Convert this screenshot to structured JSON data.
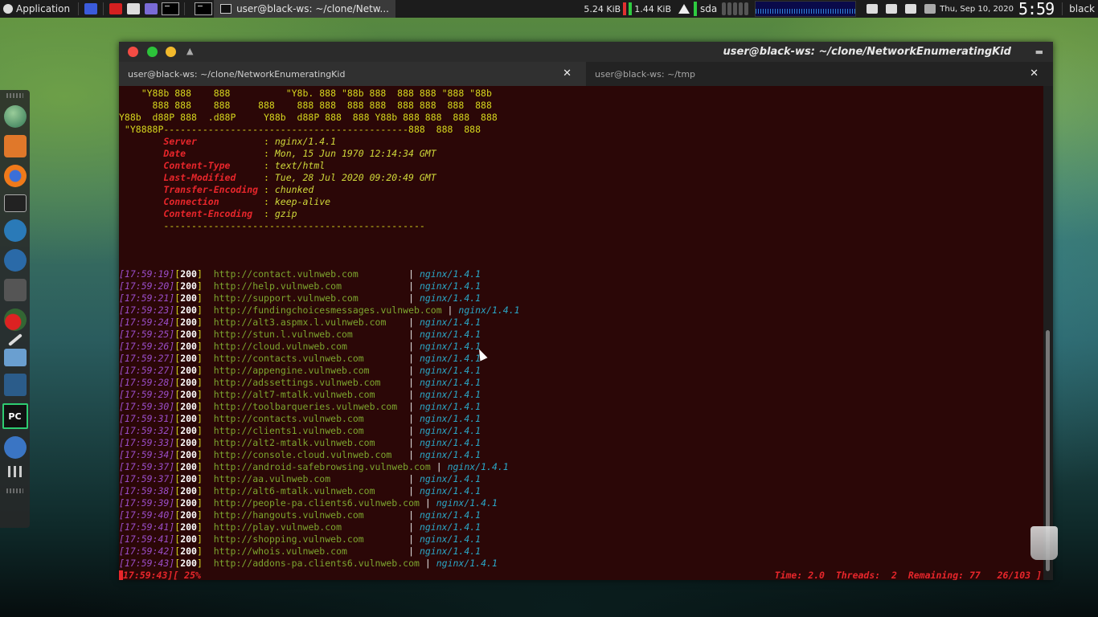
{
  "top_panel": {
    "app_menu": "Application",
    "task_label": "user@black-ws: ~/clone/Netw...",
    "net_down": "5.24 KiB",
    "net_up": "1.44 KiB",
    "disk_label": "sda",
    "date": "Thu, Sep 10, 2020",
    "time": "5:59",
    "user": "black"
  },
  "window": {
    "title": "user@black-ws: ~/clone/NetworkEnumeratingKid",
    "tabs": [
      {
        "label": "user@black-ws: ~/clone/NetworkEnumeratingKid",
        "close": "✕"
      },
      {
        "label": "user@black-ws: ~/tmp",
        "close": "✕"
      }
    ]
  },
  "terminal": {
    "ascii": [
      "    \"Y88b 888    888          \"Y8b. 888 \"88b 888  888 888 \"888 \"88b",
      "      888 888    888     888    888 888  888 888  888 888  888  888",
      "Y88b  d88P 888  .d88P     Y88b  d88P 888  888 Y88b 888 888  888  888",
      " \"Y8888P--------------------------------------------888  888  888"
    ],
    "headers": [
      {
        "key": "Server            ",
        "value": "nginx/1.4.1"
      },
      {
        "key": "Date              ",
        "value": "Mon, 15 Jun 1970 12:14:34 GMT"
      },
      {
        "key": "Content-Type      ",
        "value": "text/html"
      },
      {
        "key": "Last-Modified     ",
        "value": "Tue, 28 Jul 2020 09:20:49 GMT"
      },
      {
        "key": "Transfer-Encoding ",
        "value": "chunked"
      },
      {
        "key": "Connection        ",
        "value": "keep-alive"
      },
      {
        "key": "Content-Encoding  ",
        "value": "gzip"
      }
    ],
    "separator": "-----------------------------------------------",
    "results": [
      {
        "time": "17:59:19",
        "code": "200",
        "url": "http://contact.vulnweb.com        ",
        "server": "nginx/1.4.1"
      },
      {
        "time": "17:59:20",
        "code": "200",
        "url": "http://help.vulnweb.com           ",
        "server": "nginx/1.4.1"
      },
      {
        "time": "17:59:21",
        "code": "200",
        "url": "http://support.vulnweb.com        ",
        "server": "nginx/1.4.1"
      },
      {
        "time": "17:59:23",
        "code": "200",
        "url": "http://fundingchoicesmessages.vulnweb.com",
        "server": "nginx/1.4.1"
      },
      {
        "time": "17:59:24",
        "code": "200",
        "url": "http://alt3.aspmx.l.vulnweb.com   ",
        "server": "nginx/1.4.1"
      },
      {
        "time": "17:59:25",
        "code": "200",
        "url": "http://stun.l.vulnweb.com         ",
        "server": "nginx/1.4.1"
      },
      {
        "time": "17:59:26",
        "code": "200",
        "url": "http://cloud.vulnweb.com          ",
        "server": "nginx/1.4.1"
      },
      {
        "time": "17:59:27",
        "code": "200",
        "url": "http://contacts.vulnweb.com       ",
        "server": "nginx/1.4.1"
      },
      {
        "time": "17:59:27",
        "code": "200",
        "url": "http://appengine.vulnweb.com      ",
        "server": "nginx/1.4.1"
      },
      {
        "time": "17:59:28",
        "code": "200",
        "url": "http://adssettings.vulnweb.com    ",
        "server": "nginx/1.4.1"
      },
      {
        "time": "17:59:29",
        "code": "200",
        "url": "http://alt7-mtalk.vulnweb.com     ",
        "server": "nginx/1.4.1"
      },
      {
        "time": "17:59:30",
        "code": "200",
        "url": "http://toolbarqueries.vulnweb.com ",
        "server": "nginx/1.4.1"
      },
      {
        "time": "17:59:31",
        "code": "200",
        "url": "http://contacts.vulnweb.com       ",
        "server": "nginx/1.4.1"
      },
      {
        "time": "17:59:32",
        "code": "200",
        "url": "http://clients1.vulnweb.com       ",
        "server": "nginx/1.4.1"
      },
      {
        "time": "17:59:33",
        "code": "200",
        "url": "http://alt2-mtalk.vulnweb.com     ",
        "server": "nginx/1.4.1"
      },
      {
        "time": "17:59:34",
        "code": "200",
        "url": "http://console.cloud.vulnweb.com  ",
        "server": "nginx/1.4.1"
      },
      {
        "time": "17:59:37",
        "code": "200",
        "url": "http://android-safebrowsing.vulnweb.com",
        "server": "nginx/1.4.1"
      },
      {
        "time": "17:59:37",
        "code": "200",
        "url": "http://aa.vulnweb.com             ",
        "server": "nginx/1.4.1"
      },
      {
        "time": "17:59:38",
        "code": "200",
        "url": "http://alt6-mtalk.vulnweb.com     ",
        "server": "nginx/1.4.1"
      },
      {
        "time": "17:59:39",
        "code": "200",
        "url": "http://people-pa.clients6.vulnweb.com",
        "server": "nginx/1.4.1"
      },
      {
        "time": "17:59:40",
        "code": "200",
        "url": "http://hangouts.vulnweb.com       ",
        "server": "nginx/1.4.1"
      },
      {
        "time": "17:59:41",
        "code": "200",
        "url": "http://play.vulnweb.com           ",
        "server": "nginx/1.4.1"
      },
      {
        "time": "17:59:41",
        "code": "200",
        "url": "http://shopping.vulnweb.com       ",
        "server": "nginx/1.4.1"
      },
      {
        "time": "17:59:42",
        "code": "200",
        "url": "http://whois.vulnweb.com          ",
        "server": "nginx/1.4.1"
      },
      {
        "time": "17:59:43",
        "code": "200",
        "url": "http://addons-pa.clients6.vulnweb.com",
        "server": "nginx/1.4.1"
      }
    ],
    "status": {
      "time": "17:59:43",
      "percent": " 25%",
      "right": "Time: 2.0  Threads:  2  Remaining: 77   26/103 ]"
    }
  },
  "dock": {
    "icons": [
      "globe-icon",
      "tool-icon",
      "firefox-icon",
      "terminal-icon",
      "wireshark-icon",
      "monitor-icon",
      "flask-icon",
      "cherry-icon",
      "pen-icon",
      "folder-icon",
      "mixer-icon",
      "pycharm-icon",
      "bolt-icon",
      "grid-icon"
    ]
  },
  "colors": {
    "terminal_bg": "#2b0707",
    "ascii": "#d6d61e",
    "header_key": "#e8262b",
    "url": "#7da62f",
    "server": "#2aa6c6",
    "timestamp": "#9a4dc8"
  }
}
